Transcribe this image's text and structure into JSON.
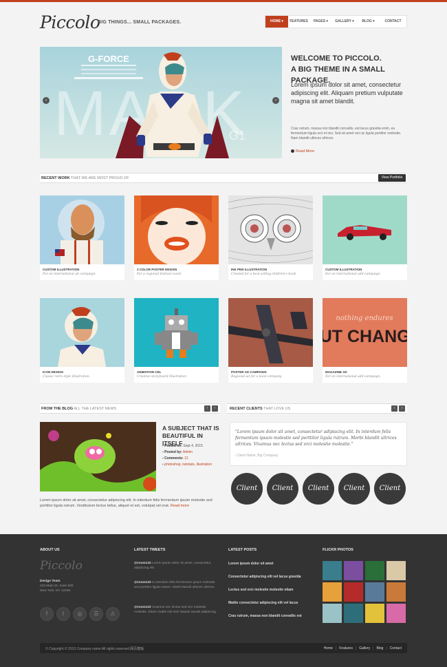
{
  "brand": {
    "logo": "Piccolo",
    "tagline": "BIG THINGS... SMALL PACKAGES."
  },
  "nav": {
    "items": [
      {
        "label": "HOME ▾",
        "active": true
      },
      {
        "label": "FEATURES"
      },
      {
        "label": "PAGES ▾"
      },
      {
        "label": "GALLERY ▾"
      },
      {
        "label": "BLOG ▾"
      },
      {
        "label": "CONTACT"
      }
    ]
  },
  "hero": {
    "small1": "G-FORCE",
    "big": "MARK",
    "badge": "G1",
    "prev": "‹",
    "next": "›"
  },
  "welcome": {
    "heading1": "WELCOME TO PICCOLO.",
    "heading2": "A BIG THEME IN A SMALL PACKAGE.",
    "lead": "Lorem ipsum dolor sit amet, consectetur adipiscing elit. Aliquam pretium vulputate magna sit amet blandit.",
    "small": "Cras rutrum, massa non blandit convallis, est lacus gravida enim, eu fermentum ligula orci et nisi. Sed sit amet orci ac ligula porttitor molestie. Nam blandit ultrices ultrices.",
    "readmore": "Read More"
  },
  "recent_work": {
    "title": "RECENT WORK",
    "subtitle": "THAT WE ARE MOST PROUD OF",
    "button": "View Portfolio"
  },
  "portfolio": [
    {
      "title": "CUSTOM ILLUSTRATION",
      "desc": "For an international ad campaign."
    },
    {
      "title": "3 COLOR POSTER DESIGN",
      "desc": "For a regional festival event."
    },
    {
      "title": "INK PEN ILLUSTRATION",
      "desc": "Created for a best selling children's book."
    },
    {
      "title": "CUSTOM ILLUSTRATION",
      "desc": "For an international add campaign."
    },
    {
      "title": "ICON DESIGN",
      "desc": "Classic retro style illustration."
    },
    {
      "title": "ANIMATION CEL",
      "desc": "Creative storyboard illustration"
    },
    {
      "title": "POSTER AD CAMPAIGN",
      "desc": "Regional ad for a local company."
    },
    {
      "title": "MAGAZINE AD",
      "desc": "For an international add campaign."
    }
  ],
  "magazine": {
    "top": "nothing endures",
    "big": "BUT CHANGE"
  },
  "blog": {
    "title": "FROM THE BLOG",
    "subtitle": "ALL THE LATEST NEWS",
    "post_title": "A SUBJECT THAT IS BEAUTIFUL IN ITSELF",
    "posted_on_label": "Posted on:",
    "posted_on": "Sept 4, 2015",
    "posted_by_label": "Posted by:",
    "posted_by": "Admin",
    "comments_label": "Comments:",
    "comments": "12",
    "tags": "photoshop, tutorials, illustration",
    "excerpt": "Lorem ipsum dolor sit amet, consectetur adipiscing elit. In interdum felis fermentum ipsum molestie sed porttitor ligula rutrum. Vestibulum lectus tellus, aliquet et est, volutpat vel erat.",
    "readmore": "Read more"
  },
  "clients": {
    "title": "RECENT CLIENTS",
    "subtitle": "THAT LOVE US",
    "quote": "\"Lorem ipsum dolor sit amet, consectetur adipiscing elit. In interdum felis fermentum ipsum molestie sed porttitor ligula rutrum. Morbi blandit ultrices ultrices. Vivamus nec lectus sed orci molestie molestie.\"",
    "by": "- Client Name, Big Company",
    "logos": [
      "Client",
      "Client",
      "Client",
      "Client",
      "Client"
    ]
  },
  "footer": {
    "about_title": "ABOUT US",
    "logo": "Piccolo",
    "team": "Design Team",
    "addr1": "123 Main St, Suite 500",
    "addr2": "New York, NY 12345",
    "tweets_title": "LATEST TWEETS",
    "tweets": [
      {
        "user": "@room122",
        "text": "Lorem ipsum dolor sit amet, consectetur adipiscing elit."
      },
      {
        "user": "@room122",
        "text": "In interdum felis fermentum ipsum molestie sed porttitor ligula rutrum. Morbi blandit ultrices ultrices."
      },
      {
        "user": "@room122",
        "text": "Vivamus nec lectus sed orci molestie molestie. Etiam mattis nisl sed. Mauris iaculis adipiscing."
      }
    ],
    "posts_title": "LATEST POSTS",
    "posts": [
      "Lorem ipsum dolor sit amet",
      "Consectetur adipiscing elit vel lacus gravida",
      "Lectus sed orci molestie molestie etiam",
      "Mattis consectetur adipiscing elit vel lacus",
      "Cras rutrum, massa non blandit convallis est"
    ],
    "flickr_title": "FLICKR PHOTOS",
    "social": [
      "f",
      "t",
      "◎",
      "☰",
      "⚠"
    ],
    "copyright": "© Copyright © 2013 Company name All rights reserved.网页模板",
    "links": [
      "Home",
      "Features",
      "Gallery",
      "Blog",
      "Contact"
    ]
  }
}
